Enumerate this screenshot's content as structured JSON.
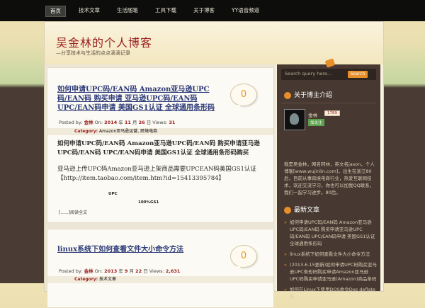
{
  "nav": {
    "items": [
      {
        "label": "首页"
      },
      {
        "label": "技术文章"
      },
      {
        "label": "生活随笔"
      },
      {
        "label": "工具下载"
      },
      {
        "label": "关于博客"
      },
      {
        "label": "YY语音频道"
      }
    ]
  },
  "site": {
    "title": "吴金林的个人博客",
    "description": "—分享技术与生活的点点滴滴记录"
  },
  "posts": [
    {
      "title": "如何申请UPC码/EAN码 Amazon亚马逊UPC码/EAN码 购买申请 亚马逊UPC码/EAN码 UPC/EAN码申请 美国GS1认证 全球通用条形码",
      "comments": "0",
      "meta": {
        "posted_by_label": "Posted by:",
        "author": "金林",
        "on_label": "On:",
        "year": "2014",
        "month": "11",
        "day": "26",
        "views_label": "Views:",
        "views": "31"
      },
      "category_label": "Category:",
      "categories": "Amazon亚马逊运营, 跨境电商",
      "excerpt_bold": "如何申请UPC码/EAN码 Amazon亚马逊UPC码/EAN码 购买申请亚马逊UPC码/EAN码 UPC/EAN码申请 美国GS1认证 全球通用条形码购买",
      "excerpt": "亚马逊上传UPC码Amazon亚马逊上架商品需要UPCEAN码美国GS1认证【http://item.taobao.com/item.htm?id=15413395784】",
      "line_a": "UPC",
      "line_b": "100%GS1",
      "more": "[......]阅读全文"
    },
    {
      "title": "linux系统下如何查看文件大小命令方法",
      "comments": "0",
      "meta": {
        "posted_by_label": "Posted by:",
        "author": "金林",
        "on_label": "On:",
        "year": "2013",
        "month": "9",
        "day": "22",
        "views_label": "Views:",
        "views": "2,631"
      },
      "category_label": "Category:",
      "categories": "技术文章"
    }
  ],
  "sidebar": {
    "search_placeholder": "Search query here...",
    "search_button": "Search",
    "widget1_title": "关于博主介绍",
    "profile": {
      "name": "金林",
      "count": "1789",
      "follow": "加关注"
    },
    "about": "我是吴金林，网名阿林，英文名jason，个人博客[www.wujinlin.com]，出生在浙江80后，目前从事跨境电商行业，热爱互联网技术，欢迎交流学习，你也可以加我QQ联系，我们一起学习进步。80后。",
    "widget2_title": "最新文章",
    "links": [
      "如何申请UPC码/EAN码 Amazon亚马逊UPC码/EAN码 购买申请亚马逊UPC码/EAN码 UPC/EAN码申请 美国GS1认证 全球通用条形码",
      "linux系统下如何查看文件大小命令方法",
      "(2013.6.15更新)如何申请UPC码购买亚马逊UPC条形码购买申请Amazon亚马逊UPC码购买申请亚马逊(Amazon)商品条码",
      "如何在Linux下使用DOS命令Dos deflate防"
    ]
  },
  "colors": {
    "accent": "#e78f2a",
    "title_red": "#9a1d1d",
    "link_blue": "#2c3a78",
    "sidebar_bg": "#473931"
  }
}
